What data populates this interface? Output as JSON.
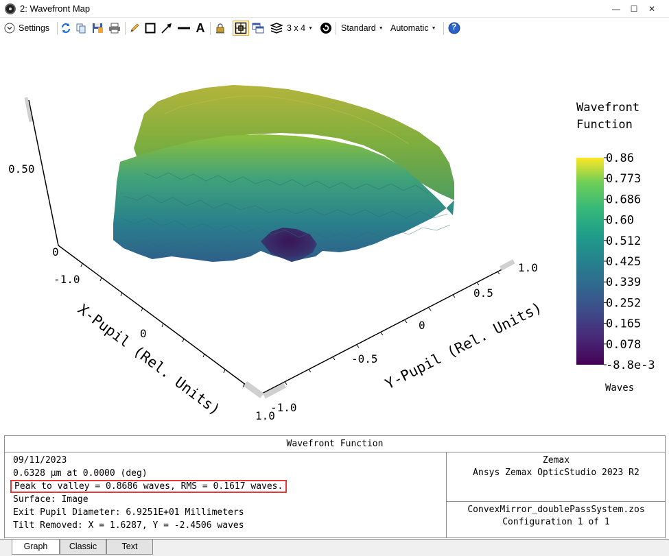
{
  "window": {
    "title": "2: Wavefront Map",
    "minimize": "—",
    "maximize": "☐",
    "close": "✕"
  },
  "toolbar": {
    "settings_label": "Settings",
    "layout_label": "3 x 4",
    "standard_label": "Standard",
    "automatic_label": "Automatic",
    "text_tool_label": "A",
    "help_label": "?"
  },
  "plot": {
    "z_ticks": [
      "0.50",
      "0"
    ],
    "x_axis": {
      "title": "X-Pupil (Rel. Units)",
      "ticks": [
        "-1.0",
        "0",
        "1.0"
      ]
    },
    "y_axis": {
      "title": "Y-Pupil (Rel. Units)",
      "ticks": [
        "1.0",
        "0.5",
        "0",
        "-0.5",
        "-1.0"
      ]
    },
    "legend": {
      "title_line1": "Wavefront",
      "title_line2": "Function",
      "units": "Waves",
      "ticks": [
        "0.86",
        "0.773",
        "0.686",
        "0.60",
        "0.512",
        "0.425",
        "0.339",
        "0.252",
        "0.165",
        "0.078",
        "-8.8e-3"
      ],
      "colors": [
        "#fde725",
        "#b5de2b",
        "#6ece58",
        "#35b779",
        "#1f9e89",
        "#26828e",
        "#31688e",
        "#3e4989",
        "#482878",
        "#440154"
      ]
    }
  },
  "info": {
    "title": "Wavefront Function",
    "date": "09/11/2023",
    "wavelength": "0.6328 µm at 0.0000 (deg)",
    "pv_rms": "Peak to valley = 0.8686 waves, RMS = 0.1617 waves.",
    "surface": "Surface: Image",
    "exit_pupil": "Exit Pupil Diameter: 6.9251E+01 Millimeters",
    "tilt": "Tilt Removed: X = 1.6287, Y = -2.4506 waves",
    "company": "Zemax",
    "product": "Ansys Zemax OpticStudio 2023 R2",
    "file": "ConvexMirror_doublePassSystem.zos",
    "configuration": "Configuration 1 of 1"
  },
  "tabs": [
    {
      "label": "Graph",
      "active": true
    },
    {
      "label": "Classic",
      "active": false
    },
    {
      "label": "Text",
      "active": false
    }
  ]
}
